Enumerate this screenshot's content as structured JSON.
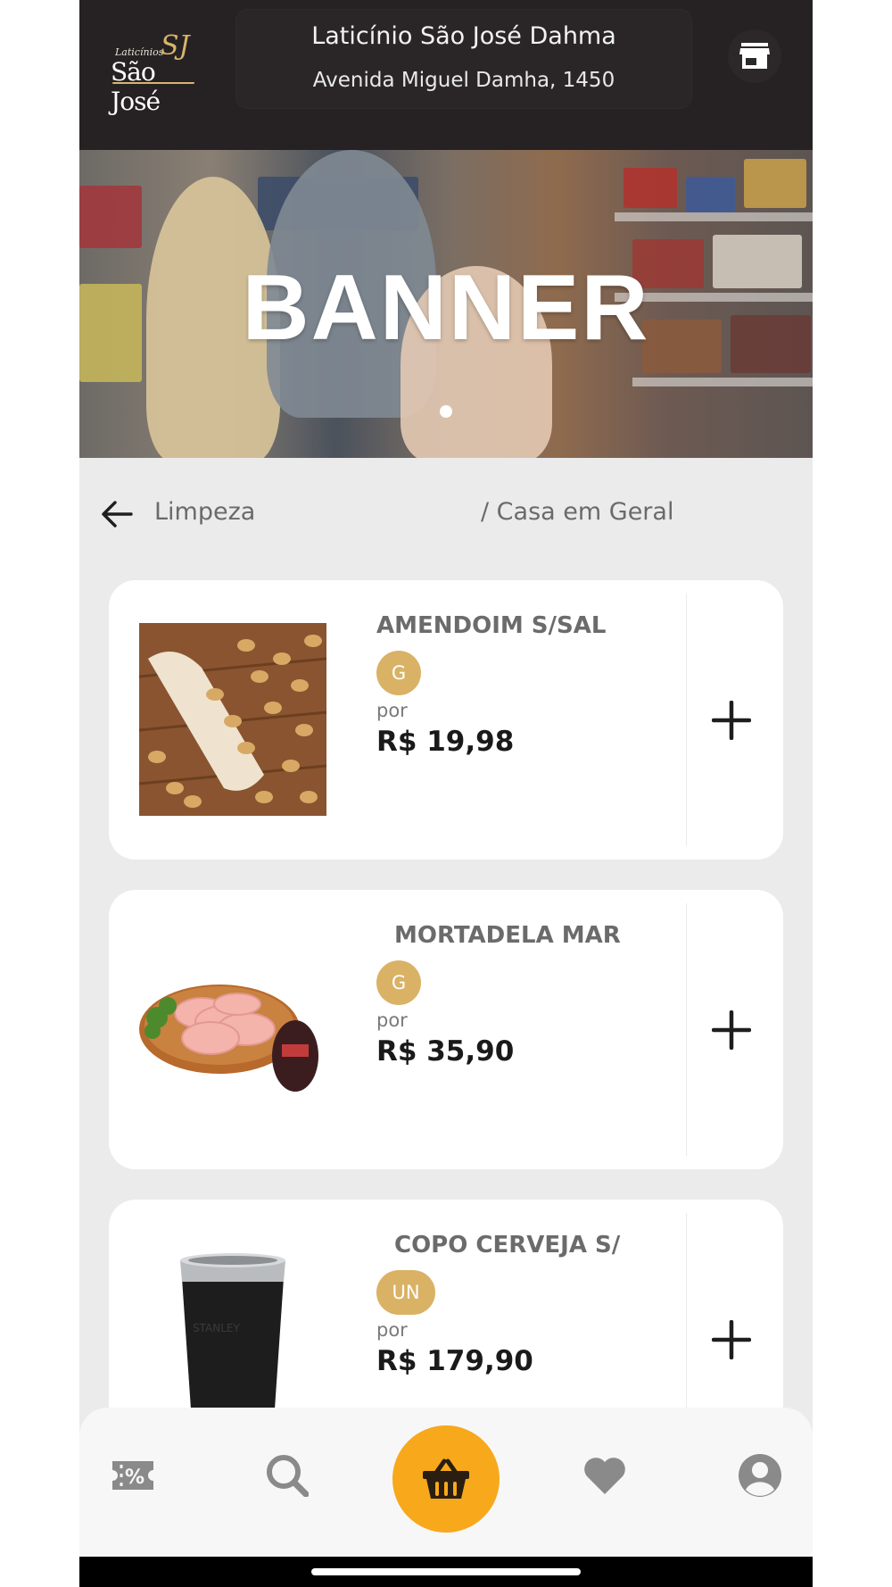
{
  "header": {
    "logo_small": "Laticínios",
    "logo_mark": "SJ",
    "logo_name": "São José",
    "store_name": "Laticínio São José Dahma",
    "store_address": "Avenida Miguel Damha, 1450",
    "store_icon": "storefront-icon"
  },
  "banner": {
    "title": "BANNER",
    "slides_total": 1,
    "active_slide": 1
  },
  "breadcrumb": {
    "back_icon": "arrow-left-icon",
    "category": "Limpeza",
    "subcategory": "/ Casa em Geral"
  },
  "products": [
    {
      "name": "AMENDOIM S/SAL",
      "unit": "G",
      "price_prefix": "por",
      "price": "R$ 19,98",
      "image": "peanuts-photo",
      "add_icon": "plus-icon"
    },
    {
      "name": "MORTADELA MARBA",
      "unit": "G",
      "price_prefix": "por",
      "price": "R$ 35,90",
      "image": "mortadella-photo",
      "add_icon": "plus-icon"
    },
    {
      "name": "COPO CERVEJA S/ TA",
      "unit": "UN",
      "price_prefix": "por",
      "price": "R$ 179,90",
      "image": "tumbler-photo",
      "add_icon": "plus-icon"
    }
  ],
  "bottom_nav": {
    "items": [
      {
        "icon": "discount-ticket-icon"
      },
      {
        "icon": "search-icon"
      },
      {
        "icon": "shopping-basket-icon"
      },
      {
        "icon": "heart-icon"
      },
      {
        "icon": "user-profile-icon"
      }
    ]
  },
  "colors": {
    "header_bg": "#262223",
    "accent_gold": "#d9b265",
    "cart_orange": "#f7a81b",
    "page_bg": "#ebebeb"
  }
}
